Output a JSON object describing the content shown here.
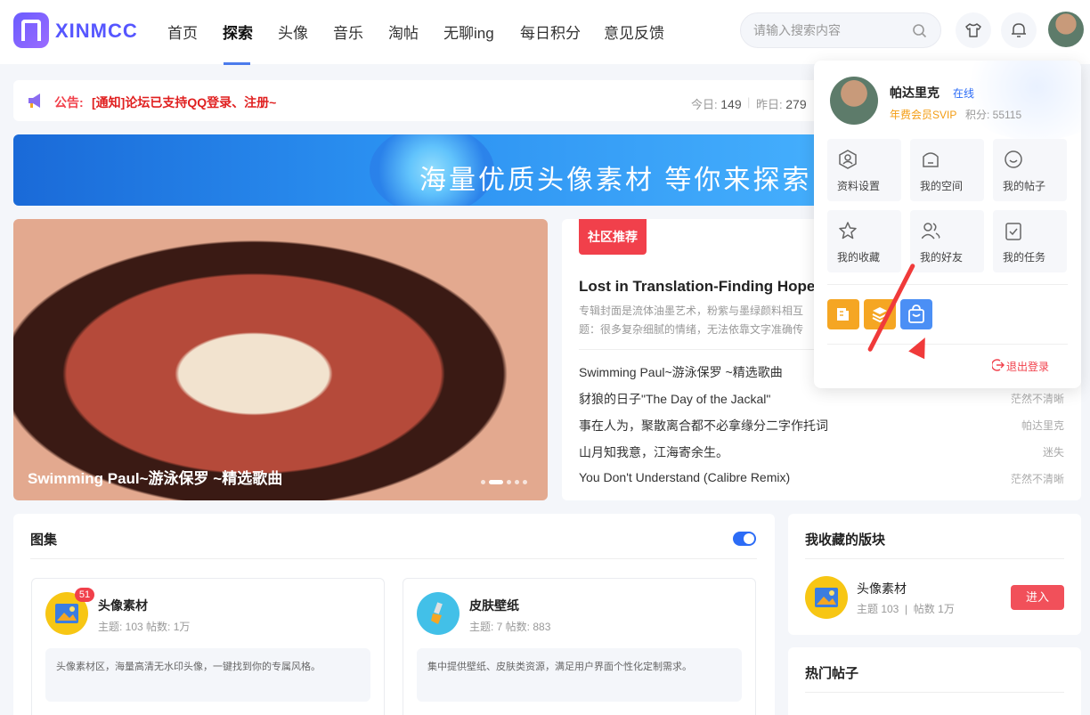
{
  "header": {
    "logo_text": "XINMCC",
    "nav": [
      "首页",
      "探索",
      "头像",
      "音乐",
      "淘帖",
      "无聊ing",
      "每日积分",
      "意见反馈"
    ],
    "active_nav": "探索",
    "search_placeholder": "请输入搜索内容"
  },
  "notice": {
    "label": "公告:",
    "text": "[通知]论坛已支持QQ登录、注册~",
    "today_label": "今日:",
    "today_value": "149",
    "yesterday_label": "昨日:",
    "yesterday_value": "279"
  },
  "banner": {
    "text": "海量优质头像素材 等你来探索"
  },
  "slider": {
    "caption": "Swimming Paul~游泳保罗 ~精选歌曲",
    "slide_count": 5,
    "active_slide": 2
  },
  "community": {
    "badge": "社区推荐",
    "featured_title": "Lost in Translation-Finding Hope",
    "featured_desc": "专辑封面是流体油墨艺术，粉紫与墨绿颜料相互题：很多复杂细腻的情绪，无法依靠文字准确传",
    "posts": [
      {
        "title": "Swimming Paul~游泳保罗 ~精选歌曲",
        "author": ""
      },
      {
        "title": "豺狼的日子\"The Day of the Jackal\"",
        "author": "茫然不清晰"
      },
      {
        "title": "事在人为，聚散离合都不必拿缘分二字作托词",
        "author": "帕达里克"
      },
      {
        "title": "山月知我意，江海寄余生。",
        "author": "迷失"
      },
      {
        "title": "You Don't Understand (Calibre Remix)",
        "author": "茫然不清晰"
      }
    ]
  },
  "album": {
    "title": "图集",
    "boards": [
      {
        "name": "头像素材",
        "meta": "主题: 103    帖数: 1万",
        "desc": "头像素材区，海量高清无水印头像，一键找到你的专属风格。",
        "badge": "51",
        "icon": "image-icon"
      },
      {
        "name": "皮肤壁纸",
        "meta": "主题: 7    帖数: 883",
        "desc": "集中提供壁纸、皮肤类资源，满足用户界面个性化定制需求。",
        "icon": "brush-icon"
      }
    ]
  },
  "favorites": {
    "title": "我收藏的版块",
    "board_name": "头像素材",
    "board_meta": "主题 103  |  帖数 1万",
    "enter_label": "进入"
  },
  "hot": {
    "title": "热门帖子"
  },
  "user_panel": {
    "name": "帕达里克",
    "status": "在线",
    "vip": "年费会员SVIP",
    "points": "积分: 55115",
    "tiles": [
      {
        "label": "资料设置",
        "icon": "user-settings-icon"
      },
      {
        "label": "我的空间",
        "icon": "home-icon"
      },
      {
        "label": "我的帖子",
        "icon": "chat-icon"
      },
      {
        "label": "我的收藏",
        "icon": "star-icon"
      },
      {
        "label": "我的好友",
        "icon": "friends-icon"
      },
      {
        "label": "我的任务",
        "icon": "task-icon"
      }
    ],
    "quick_colors": [
      "#f5a623",
      "#f5a623",
      "#4b8ff5"
    ],
    "logout": "退出登录"
  },
  "colors": {
    "accent": "#2c6cf6",
    "danger": "#f1404b",
    "brand": "#5656ff"
  }
}
